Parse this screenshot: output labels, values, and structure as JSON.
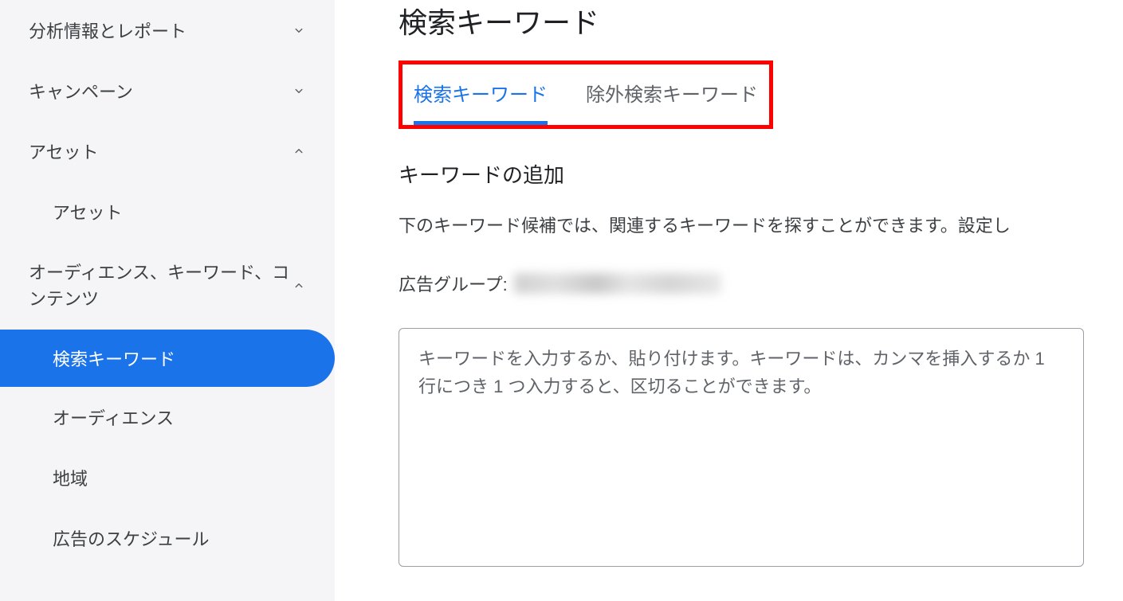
{
  "sidebar": {
    "items": [
      {
        "label": "分析情報とレポート",
        "expanded": false,
        "level": 0
      },
      {
        "label": "キャンペーン",
        "expanded": false,
        "level": 0
      },
      {
        "label": "アセット",
        "expanded": true,
        "level": 0
      },
      {
        "label": "アセット",
        "level": 1
      },
      {
        "label": "オーディエンス、キーワード、コンテンツ",
        "expanded": true,
        "level": 0
      },
      {
        "label": "検索キーワード",
        "level": 1,
        "active": true
      },
      {
        "label": "オーディエンス",
        "level": 1
      },
      {
        "label": "地域",
        "level": 1
      },
      {
        "label": "広告のスケジュール",
        "level": 1
      }
    ]
  },
  "main": {
    "page_title": "検索キーワード",
    "tabs": [
      {
        "label": "検索キーワード",
        "active": true
      },
      {
        "label": "除外検索キーワード",
        "active": false
      }
    ],
    "section_title": "キーワードの追加",
    "description": "下のキーワード候補では、関連するキーワードを探すことができます。設定し",
    "ad_group_label": "広告グループ:",
    "textarea_placeholder": "キーワードを入力するか、貼り付けます。キーワードは、カンマを挿入するか 1 行につき 1 つ入力すると、区切ることができます。"
  }
}
